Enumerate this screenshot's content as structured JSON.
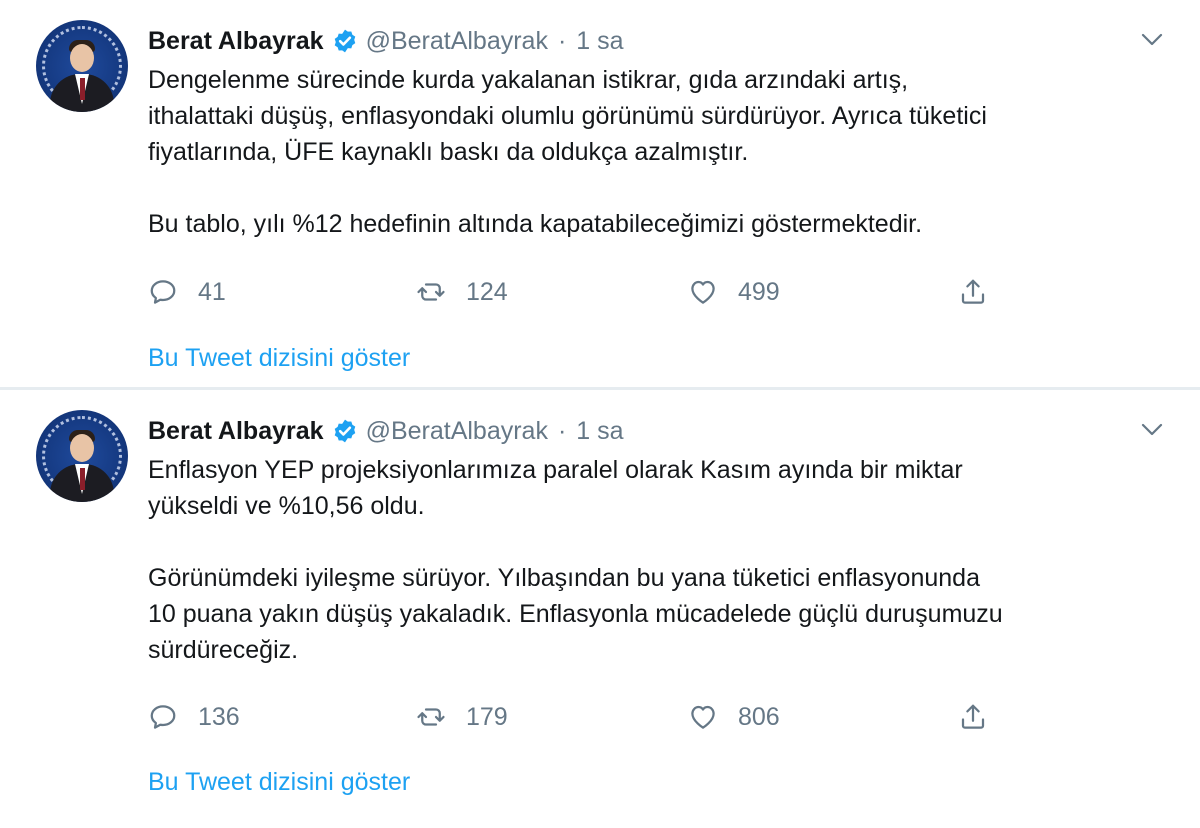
{
  "tweets": [
    {
      "name": "Berat Albayrak",
      "handle": "@BeratAlbayrak",
      "separator": "·",
      "time": "1 sa",
      "paragraphs": [
        "Dengelenme sürecinde kurda yakalanan istikrar, gıda arzındaki artış,\nithalattaki düşüş, enflasyondaki olumlu görünümü sürdürüyor. Ayrıca tüketici\nfiyatlarında, ÜFE kaynaklı baskı da oldukça azalmıştır.",
        "Bu tablo, yılı %12 hedefinin altında kapatabileceğimizi göstermektedir."
      ],
      "replies": "41",
      "retweets": "124",
      "likes": "499",
      "show_thread": "Bu Tweet dizisini göster"
    },
    {
      "name": "Berat Albayrak",
      "handle": "@BeratAlbayrak",
      "separator": "·",
      "time": "1 sa",
      "paragraphs": [
        "Enflasyon YEP projeksiyonlarımıza paralel olarak Kasım ayında bir miktar\nyükseldi ve %10,56 oldu.",
        "Görünümdeki iyileşme sürüyor. Yılbaşından bu yana tüketici enflasyonunda\n10 puana yakın düşüş yakaladık. Enflasyonla mücadelede güçlü duruşumuzu\nsürdüreceğiz."
      ],
      "replies": "136",
      "retweets": "179",
      "likes": "806",
      "show_thread": "Bu Tweet dizisini göster"
    }
  ],
  "icons": {
    "verified": "verified-badge-icon",
    "caret": "chevron-down-icon",
    "reply": "reply-icon",
    "retweet": "retweet-icon",
    "like": "heart-icon",
    "share": "share-icon"
  },
  "colors": {
    "link": "#1da1f2",
    "secondary": "#657786",
    "text": "#14171a",
    "divider": "#e6ecf0"
  }
}
